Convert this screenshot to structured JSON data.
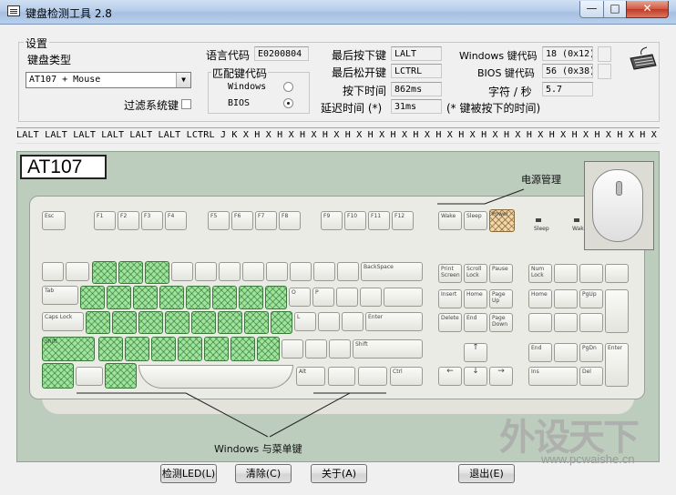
{
  "window": {
    "title": "键盘检测工具 2.8",
    "min_glyph": "—",
    "max_glyph": "□",
    "close_glyph": "✕"
  },
  "settings": {
    "group_label": "设置",
    "keyboard_type_label": "键盘类型",
    "keyboard_type_value": "AT107 + Mouse",
    "filter_system_keys_label": "过滤系统键",
    "filter_system_keys_checked": false,
    "language_code_label": "语言代码",
    "language_code_value": "E0200804",
    "match_code_label": "匹配键代码",
    "match_options": [
      {
        "label": "Windows",
        "selected": false
      },
      {
        "label": "BIOS",
        "selected": true
      }
    ],
    "last_pressed_label": "最后按下键",
    "last_pressed_value": "LALT",
    "last_released_label": "最后松开键",
    "last_released_value": "LCTRL",
    "press_time_label": "按下时间",
    "press_time_value": "862ms",
    "delay_time_label": "延迟时间 (*)",
    "delay_time_value": "31ms",
    "delay_note": "(* 键被按下的时间)",
    "windows_keycode_label": "Windows 键代码",
    "windows_keycode_value": "18 (0x12)",
    "bios_keycode_label": "BIOS 键代码",
    "bios_keycode_value": "56 (0x38)",
    "chars_per_sec_label": "字符 / 秒",
    "chars_per_sec_value": "5.7"
  },
  "history": "LALT LALT LALT LALT LALT LALT LCTRL J K X H X H X H X H X H X H X H X H X H X H X H X H X H X H X H X H X H X H X H X H X H X",
  "keyboard": {
    "model_label": "AT107",
    "power_mgmt_label": "电源管理",
    "windows_menu_label": "Windows 与菜单键",
    "sleep_label": "Sleep",
    "wake_label": "Wake",
    "keys": {
      "esc": "Esc",
      "f1": "F1",
      "f2": "F2",
      "f3": "F3",
      "f4": "F4",
      "f5": "F5",
      "f6": "F6",
      "f7": "F7",
      "f8": "F8",
      "f9": "F9",
      "f10": "F10",
      "f11": "F11",
      "f12": "F12",
      "wake_key": "Wake",
      "sleep_key": "Sleep",
      "power_key": "Power",
      "backspace": "BackSpace",
      "tab": "Tab",
      "capslock": "Caps Lock",
      "enter": "Enter",
      "lshift": "Shift",
      "rshift": "Shift",
      "ctrl": "Ctrl",
      "alt": "Alt",
      "print": "Print Screen",
      "scroll": "Scroll Lock",
      "pause": "Pause",
      "insert": "Insert",
      "home": "Home",
      "pageup": "Page Up",
      "delete": "Delete",
      "end": "End",
      "pagedown": "Page Down",
      "numlock": "Num Lock",
      "up": "↑",
      "left": "←",
      "down": "↓",
      "right": "→",
      "num_home": "Home",
      "num_end": "End",
      "num_ins": "Ins",
      "num_del": "Del",
      "num_pgup": "PgUp",
      "num_pgdn": "PgDn",
      "num_enter": "Enter",
      "o_key": "O",
      "p_key": "P",
      "l_key": "L"
    }
  },
  "buttons": {
    "detect_led": "检测LED(L)",
    "clear": "清除(C)",
    "about": "关于(A)",
    "exit": "退出(E)"
  },
  "watermark": {
    "brand": "外设天下",
    "url": "www.pcwaishe.cn"
  },
  "colors": {
    "hit_key": "#9fe39f",
    "panel": "#bccdbd",
    "power_key": "#f0d6a8"
  }
}
